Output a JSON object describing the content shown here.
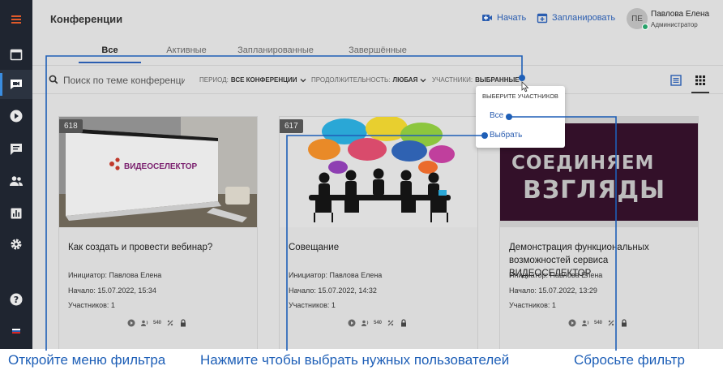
{
  "header": {
    "title": "Конференции",
    "start_label": "Начать",
    "schedule_label": "Запланировать",
    "user": {
      "initials": "ПЕ",
      "name": "Павлова Елена",
      "role": "Администратор"
    }
  },
  "tabs": [
    {
      "label": "Все",
      "active": true
    },
    {
      "label": "Активные",
      "active": false
    },
    {
      "label": "Запланированные",
      "active": false
    },
    {
      "label": "Завершённые",
      "active": false
    }
  ],
  "filters": {
    "search_placeholder": "Поиск по теме конференции",
    "period": {
      "label": "ПЕРИОД:",
      "value": "ВСЕ КОНФЕРЕНЦИИ"
    },
    "duration": {
      "label": "ПРОДОЛЖИТЕЛЬНОСТЬ:",
      "value": "ЛЮБАЯ"
    },
    "participants": {
      "label": "УЧАСТНИКИ:",
      "value": "ВЫБРАННЫЕ"
    }
  },
  "popup": {
    "title": "ВЫБЕРИТЕ УЧАСТНИКОВ",
    "items": [
      "Все",
      "Выбрать"
    ]
  },
  "cards": [
    {
      "id": "618",
      "title": "Как создать и провести вебинар?",
      "initiator": "Инициатор: Павлова Елена",
      "start": "Начало: 15.07.2022, 15:34",
      "participants": "Участников: 1",
      "thumb_brand": "ВИДЕОСЕЛЕКТОР"
    },
    {
      "id": "617",
      "title": "Совещание",
      "initiator": "Инициатор: Павлова Елена",
      "start": "Начало: 15.07.2022, 14:32",
      "participants": "Участников: 1"
    },
    {
      "id": "",
      "title": "Демонстрация функциональных возможностей сервиса ВИДЕОСЕЛЕКТОР",
      "initiator": "Инициатор: Павлова Елена",
      "start": "Начало: 15.07.2022, 13:29",
      "participants": "Участников: 1",
      "thumb_text": [
        "СОЕДИНЯЕМ",
        "ВЗГЛЯДЫ"
      ]
    }
  ],
  "resolution_badge": "540",
  "annotations": {
    "open_filter": "Откройте меню фильтра",
    "select_users": "Нажмите чтобы выбрать нужных пользователей",
    "reset_filter": "Сбросьте фильтр"
  },
  "colors": {
    "accent": "#2a5db0",
    "annotation": "#1e5fb7",
    "sidebar": "#1f2530",
    "active_indicator": "#3a8de0",
    "menu_icon": "#e05a2a"
  }
}
